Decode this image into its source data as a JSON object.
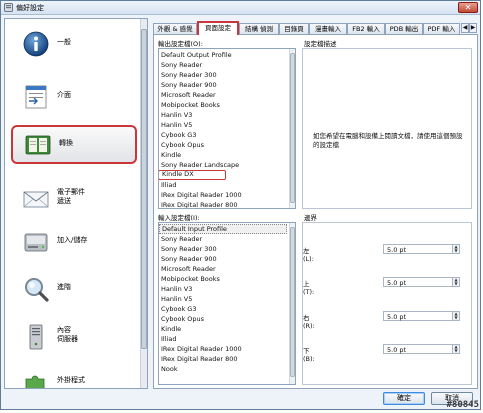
{
  "window": {
    "title": "偏好設定",
    "close_label": "✕"
  },
  "sidebar": {
    "items": [
      {
        "label": "一般",
        "icon": "info-icon"
      },
      {
        "label": "介面",
        "icon": "interface-icon"
      },
      {
        "label": "轉換",
        "icon": "convert-icon",
        "selected": true
      },
      {
        "label": "電子郵件\n遞送",
        "icon": "mail-icon"
      },
      {
        "label": "加入/儲存",
        "icon": "disk-icon"
      },
      {
        "label": "進階",
        "icon": "magnifier-icon"
      },
      {
        "label": "內容\n伺服器",
        "icon": "server-icon"
      },
      {
        "label": "外掛程式",
        "icon": "plugin-icon"
      }
    ]
  },
  "tabs": [
    {
      "label": "外觀 & 感覺"
    },
    {
      "label": "頁面設定",
      "active": true
    },
    {
      "label": "結構 偵測"
    },
    {
      "label": "目錄頁"
    },
    {
      "label": "漫畫輸入"
    },
    {
      "label": "FB2 輸入"
    },
    {
      "label": "PDB 輸出"
    },
    {
      "label": "PDF 輸入"
    }
  ],
  "output_profiles": {
    "label": "輸出設定檔(O):",
    "items": [
      "Default Output Profile",
      "Sony Reader",
      "Sony Reader 300",
      "Sony Reader 900",
      "Microsoft Reader",
      "Mobipocket Books",
      "Hanlin V3",
      "Hanlin V5",
      "Cybook G3",
      "Cybook Opus",
      "Kindle",
      "Sony Reader Landscape",
      "Kindle DX",
      "Illiad",
      "IRex Digital Reader 1000",
      "IRex Digital Reader 800"
    ],
    "highlighted": "Kindle DX"
  },
  "profile_description": {
    "label": "設定檔描述",
    "text": "如您希望在電腦和設備上閱讀文檔，請使用這個預設的設定檔"
  },
  "input_profiles": {
    "label": "輸入設定檔(I):",
    "items": [
      "Default Input Profile",
      "Sony Reader",
      "Sony Reader 300",
      "Sony Reader 900",
      "Microsoft Reader",
      "Mobipocket Books",
      "Hanlin V3",
      "Hanlin V5",
      "Cybook G3",
      "Cybook Opus",
      "Kindle",
      "Illiad",
      "IRex Digital Reader 1000",
      "IRex Digital Reader 800",
      "Nook"
    ],
    "selected": "Default Input Profile"
  },
  "margins": {
    "label": "邊界",
    "rows": [
      {
        "label": "左(L):",
        "value": "5.0 pt"
      },
      {
        "label": "上(T):",
        "value": "5.0 pt"
      },
      {
        "label": "右(R):",
        "value": "5.0 pt"
      },
      {
        "label": "下(B):",
        "value": "5.0 pt"
      }
    ]
  },
  "buttons": {
    "ok": "確定",
    "cancel": "取消"
  },
  "watermark": "#80845"
}
